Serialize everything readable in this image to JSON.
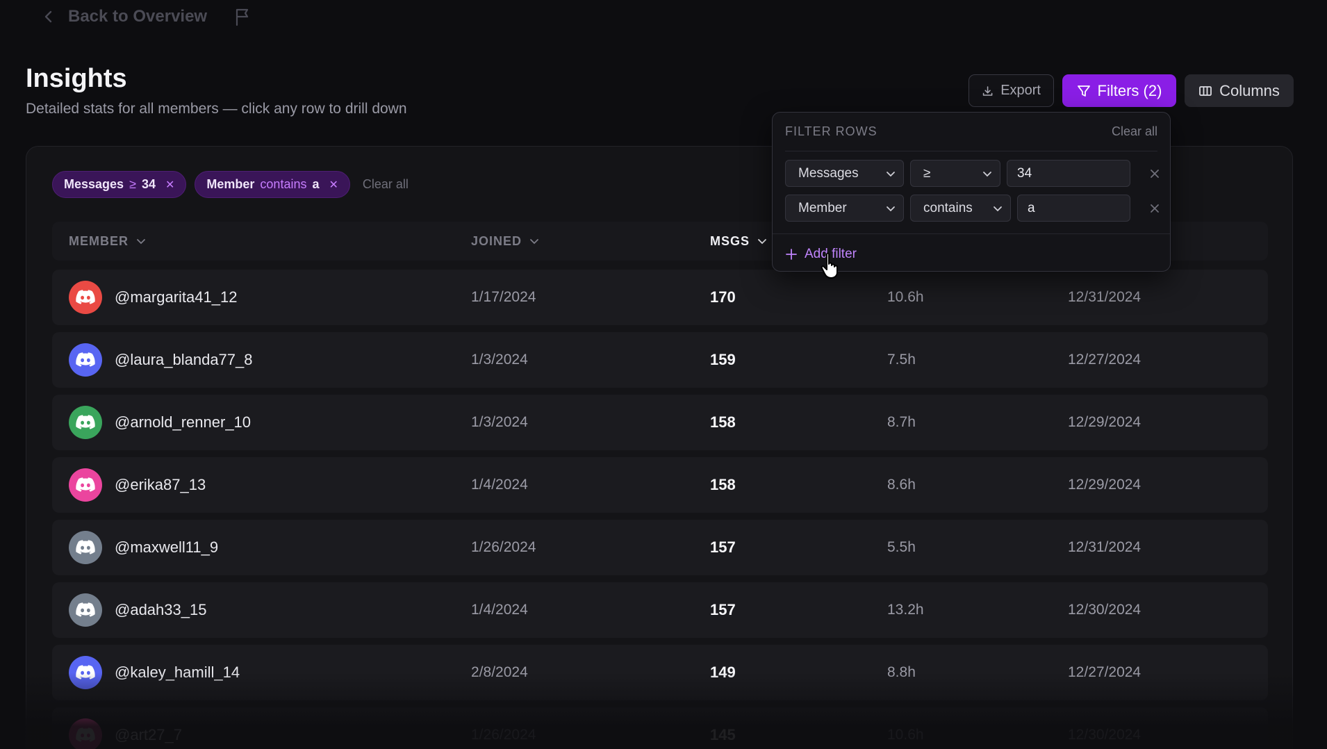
{
  "nav": {
    "back_label": "Back to Overview",
    "back_icon": "chevron-left-icon",
    "flag_icon": "flag-icon"
  },
  "header": {
    "title": "Insights",
    "subtitle": "Detailed stats for all members — click any row to drill down"
  },
  "toolbar": {
    "export_label": "Export",
    "filters_label": "Filters (2)",
    "columns_label": "Columns",
    "accent": "#8a1ee6"
  },
  "active_filters": {
    "chips": [
      {
        "field": "Messages",
        "op": "≥",
        "value": "34"
      },
      {
        "field": "Member",
        "op": "contains",
        "value": "a"
      }
    ],
    "clear_label": "Clear all"
  },
  "table": {
    "columns": [
      {
        "label": "MEMBER"
      },
      {
        "label": "JOINED"
      },
      {
        "label": "MSGS"
      }
    ],
    "rows": [
      {
        "member": "@margarita41_12",
        "joined": "1/17/2024",
        "msgs": "170",
        "voice": "10.6h",
        "last": "12/31/2024",
        "avatar_color": "#ea4a44"
      },
      {
        "member": "@laura_blanda77_8",
        "joined": "1/3/2024",
        "msgs": "159",
        "voice": "7.5h",
        "last": "12/27/2024",
        "avatar_color": "#5865f2"
      },
      {
        "member": "@arnold_renner_10",
        "joined": "1/3/2024",
        "msgs": "158",
        "voice": "8.7h",
        "last": "12/29/2024",
        "avatar_color": "#3aa55c"
      },
      {
        "member": "@erika87_13",
        "joined": "1/4/2024",
        "msgs": "158",
        "voice": "8.6h",
        "last": "12/29/2024",
        "avatar_color": "#eb459e"
      },
      {
        "member": "@maxwell11_9",
        "joined": "1/26/2024",
        "msgs": "157",
        "voice": "5.5h",
        "last": "12/31/2024",
        "avatar_color": "#747f8d"
      },
      {
        "member": "@adah33_15",
        "joined": "1/4/2024",
        "msgs": "157",
        "voice": "13.2h",
        "last": "12/30/2024",
        "avatar_color": "#747f8d"
      },
      {
        "member": "@kaley_hamill_14",
        "joined": "2/8/2024",
        "msgs": "149",
        "voice": "8.8h",
        "last": "12/27/2024",
        "avatar_color": "#5865f2"
      },
      {
        "member": "@art27_7",
        "joined": "1/26/2024",
        "msgs": "145",
        "voice": "10.6h",
        "last": "12/30/2024",
        "avatar_color": "#eb459e"
      }
    ]
  },
  "filter_panel": {
    "title": "FILTER ROWS",
    "clear_label": "Clear all",
    "rows": [
      {
        "field": "Messages",
        "op": "≥",
        "value": "34"
      },
      {
        "field": "Member",
        "op": "contains",
        "value": "a"
      }
    ],
    "add_label": "Add filter"
  }
}
